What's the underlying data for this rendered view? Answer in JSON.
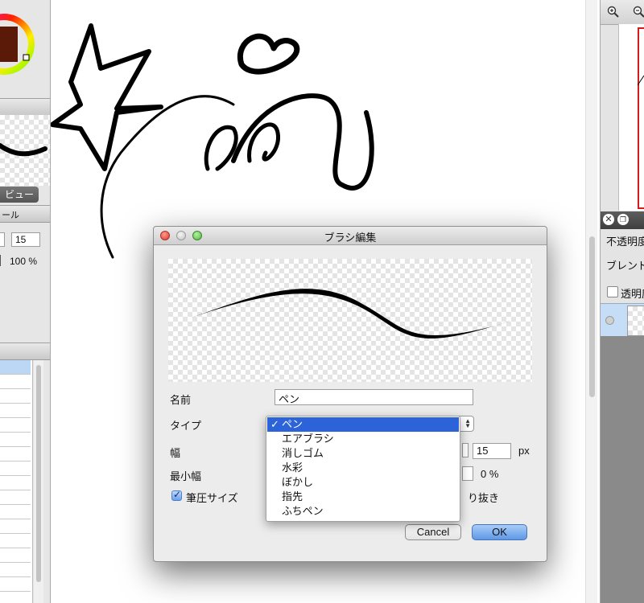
{
  "left_panel": {
    "preview_button_label": "ビュー",
    "tool_header_label": "ール",
    "width_value": "15",
    "opacity_value": "100 %"
  },
  "right_panel": {
    "opacity_label": "不透明度",
    "blend_label": "ブレンド",
    "transparency_label": "透明度"
  },
  "dialog": {
    "title": "ブラシ編集",
    "name_label": "名前",
    "name_value": "ペン",
    "type_label": "タイプ",
    "width_label": "幅",
    "width_value": "15",
    "width_unit": "px",
    "min_width_label": "最小幅",
    "min_width_value": "0 %",
    "pressure_size_label": "筆圧サイズ",
    "pressure_size_checked": true,
    "cutout_label": "り抜き",
    "cancel_label": "Cancel",
    "ok_label": "OK",
    "type_options": [
      "ペン",
      "エアブラシ",
      "消しゴム",
      "水彩",
      "ぼかし",
      "指先",
      "ふちペン"
    ],
    "type_selected": "ペン",
    "checkmark": "✓"
  },
  "colors": {
    "selection": "#2d63d8",
    "ok_button": "#6aa5f0"
  }
}
